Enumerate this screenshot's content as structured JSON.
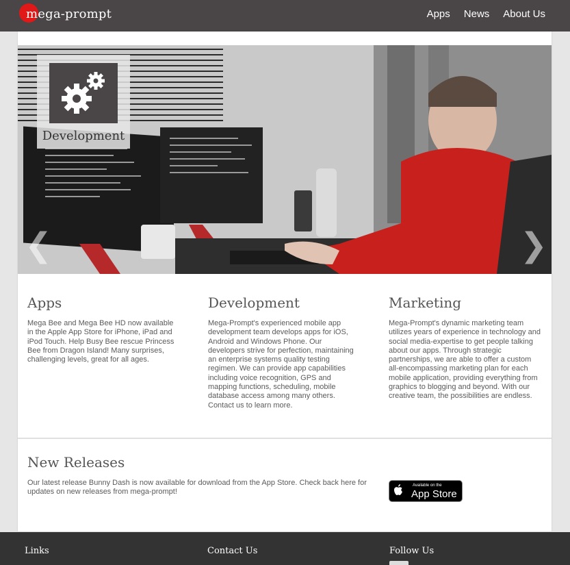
{
  "header": {
    "logo_text": "mega-prompt",
    "nav": [
      "Apps",
      "News",
      "About Us"
    ]
  },
  "hero": {
    "badge_label": "Development",
    "prev": "❮",
    "next": "❯"
  },
  "columns": [
    {
      "title": "Apps",
      "text": "Mega Bee and Mega Bee HD now available in the Apple App Store for iPhone, iPad and iPod Touch. Help Busy Bee rescue Princess Bee from Dragon Island! Many surprises, challenging levels, great for all ages."
    },
    {
      "title": "Development",
      "text": "Mega-Prompt's experienced mobile app development team develops apps for iOS, Android and Windows Phone. Our developers strive for perfection, maintaining an enterprise systems quality testing regimen. We can provide app capabilities including voice recognition, GPS and mapping functions, scheduling, mobile database access among many others. Contact us to learn more."
    },
    {
      "title": "Marketing",
      "text": "Mega-Prompt's dynamic marketing team utilizes years of experience in technology and social media-expertise to get people talking about our apps. Through strategic partnerships, we are able to offer a custom all-encompassing marketing plan for each mobile application, providing everything from graphics to blogging and beyond. With our creative team, the possibilities are endless."
    }
  ],
  "releases": {
    "title": "New Releases",
    "text": "Our latest release Bunny Dash is now available for download from the App Store. Check back here for updates on new releases from mega-prompt!"
  },
  "appstore": {
    "small": "Available on the",
    "big": "App Store"
  },
  "footer": {
    "links_title": "Links",
    "contact_title": "Contact Us",
    "follow_title": "Follow Us"
  },
  "colors": {
    "header_bg": "#4a4546",
    "accent_red": "#e01818",
    "footer_bg": "#333333"
  }
}
